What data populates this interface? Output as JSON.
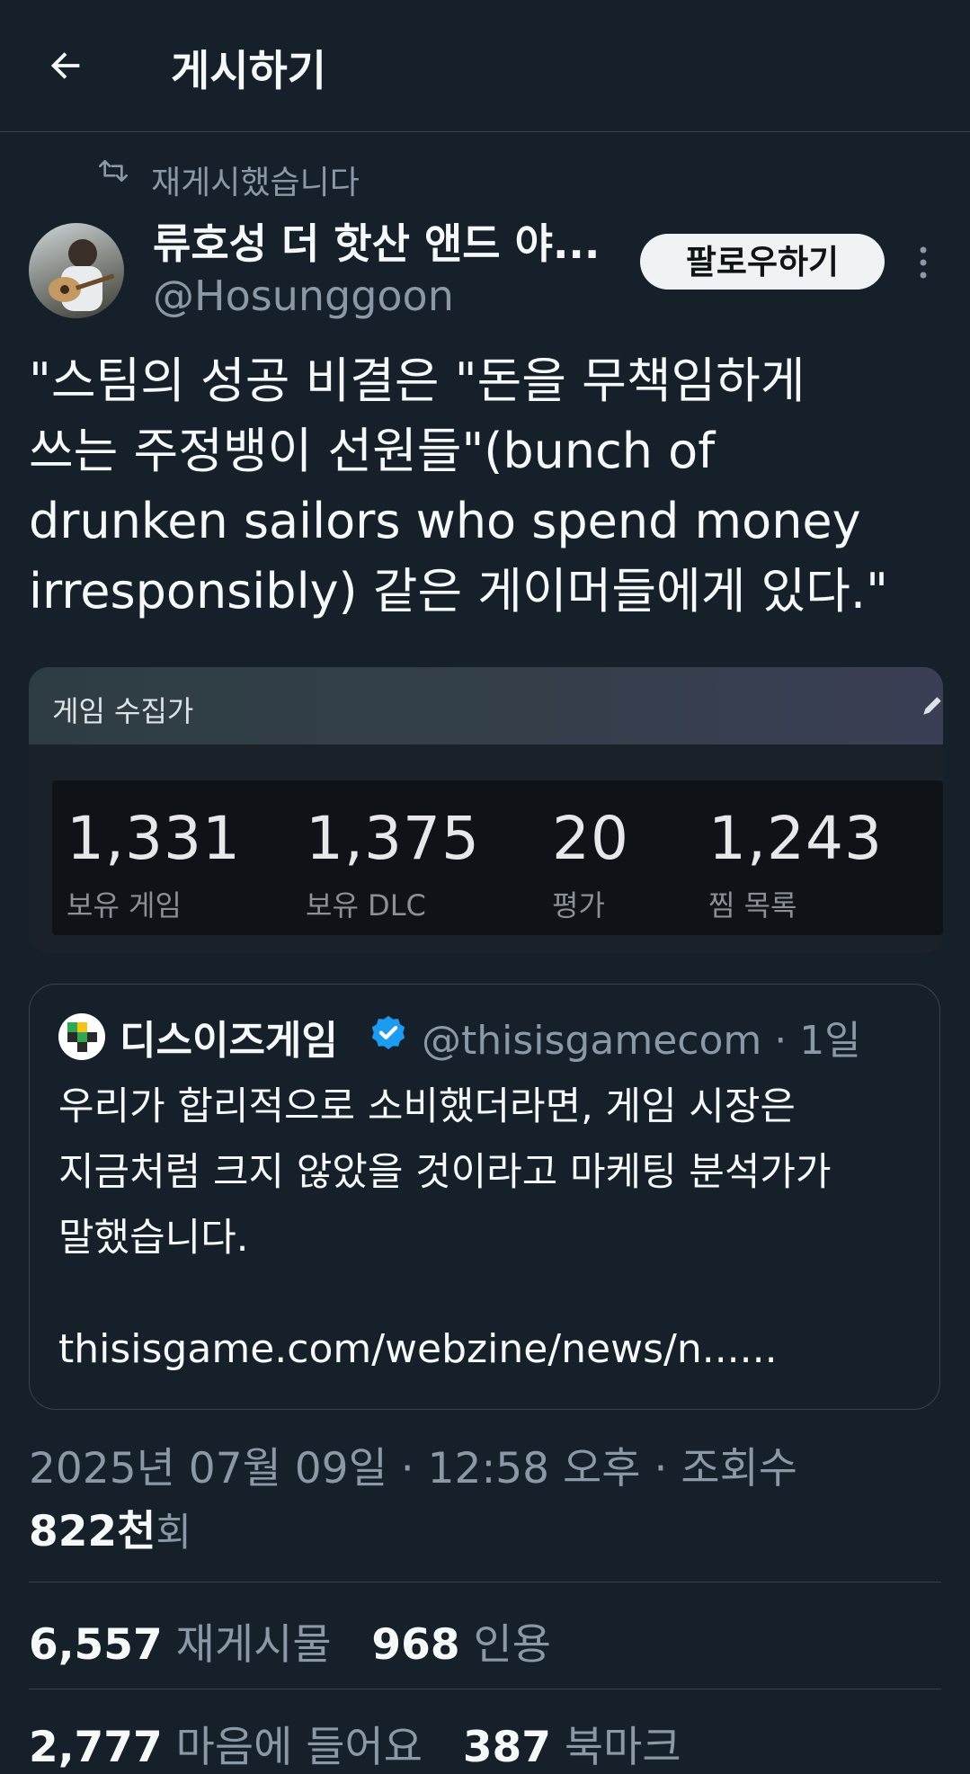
{
  "header": {
    "title": "게시하기"
  },
  "repost": {
    "label": "재게시했습니다"
  },
  "author": {
    "name": "류호성 더 핫산 앤드 야...",
    "handle": "@Hosunggoon",
    "follow_label": "팔로우하기"
  },
  "tweet": {
    "text": "\"스팀의 성공 비결은 \"돈을 무책임하게\n쓰는 주정뱅이 선원들\"(bunch of\ndrunken sailors who spend money\nirresponsibly) 같은 게이머들에게 있다.\""
  },
  "steam_card": {
    "title": "게임 수집가",
    "stats": [
      {
        "value": "1,331",
        "label": "보유 게임"
      },
      {
        "value": "1,375",
        "label": "보유 DLC"
      },
      {
        "value": "20",
        "label": "평가"
      },
      {
        "value": "1,243",
        "label": "찜 목록"
      }
    ]
  },
  "quote": {
    "name": "디스이즈게임",
    "handle": "@thisisgamecom · 1일",
    "text": "우리가 합리적으로 소비했더라면, 게임 시장은\n지금처럼 크지 않았을 것이라고 마케팅 분석가가\n말했습니다.",
    "link": "thisisgame.com/webzine/news/n......"
  },
  "meta": {
    "timestamp": "2025년 07월 09일 · 12:58 오후 · 조회수",
    "views_count": "822천",
    "views_unit": "회"
  },
  "engagement": {
    "reposts": "6,557",
    "reposts_label": "재게시물",
    "quotes": "968",
    "quotes_label": "인용",
    "likes": "2,777",
    "likes_label": "마음에 들어요",
    "bookmarks": "387",
    "bookmarks_label": "북마크"
  },
  "colors": {
    "background": "#15202b",
    "muted_text": "#8b98a5",
    "border": "#38444d",
    "verified": "#1d9bf0"
  }
}
